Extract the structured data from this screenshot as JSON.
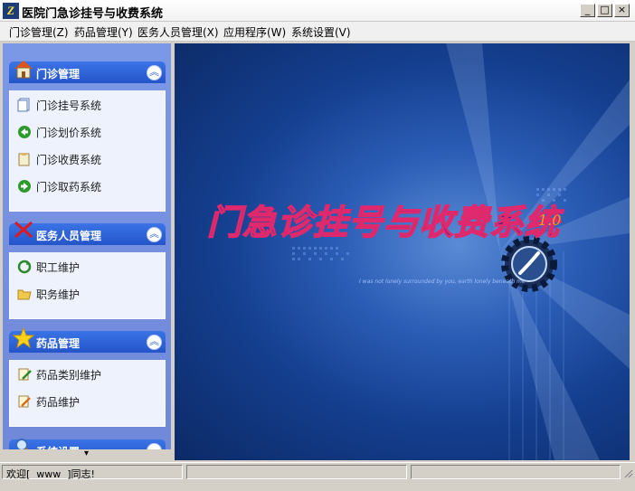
{
  "window": {
    "title": "医院门急诊挂号与收费系统",
    "minimize_label": "_",
    "maximize_label": "□",
    "close_label": "×"
  },
  "menubar": [
    {
      "label": "门诊管理(Z)"
    },
    {
      "label": "药品管理(Y)"
    },
    {
      "label": "医务人员管理(X)"
    },
    {
      "label": "应用程序(W)"
    },
    {
      "label": "系统设置(V)"
    }
  ],
  "sidebar": {
    "groups": [
      {
        "title": "门诊管理",
        "icon": "house-icon",
        "items": [
          {
            "label": "门诊挂号系统",
            "icon": "document-icon"
          },
          {
            "label": "门诊划价系统",
            "icon": "back-arrow-icon"
          },
          {
            "label": "门诊收费系统",
            "icon": "clipboard-icon"
          },
          {
            "label": "门诊取药系统",
            "icon": "forward-arrow-icon"
          }
        ]
      },
      {
        "title": "医务人员管理",
        "icon": "red-x-icon",
        "items": [
          {
            "label": "职工维护",
            "icon": "refresh-icon"
          },
          {
            "label": "职务维护",
            "icon": "folder-icon"
          }
        ]
      },
      {
        "title": "药品管理",
        "icon": "star-icon",
        "items": [
          {
            "label": "药品类别维护",
            "icon": "edit-icon"
          },
          {
            "label": "药品维护",
            "icon": "edit-pencil-icon"
          }
        ]
      },
      {
        "title": "系统设置",
        "icon": "magnifier-icon",
        "items": []
      }
    ],
    "collapse_label": "︽",
    "scroll_arrow": "▾"
  },
  "banner": {
    "title": "门急诊挂号与收费系统",
    "version": "1.0",
    "tagline": "I was not lonely surrounded by you, earth lonely beneath me",
    "colors": {
      "bg_dark": "#0c2a66",
      "bg_light": "#5a8bd6",
      "title_fill": "#2a1a8c",
      "title_stroke": "#e0286c",
      "version": "#f0a020"
    }
  },
  "statusbar": {
    "left_text": "欢迎[  www  ]同志!",
    "middle_text": "",
    "right_text": ""
  }
}
